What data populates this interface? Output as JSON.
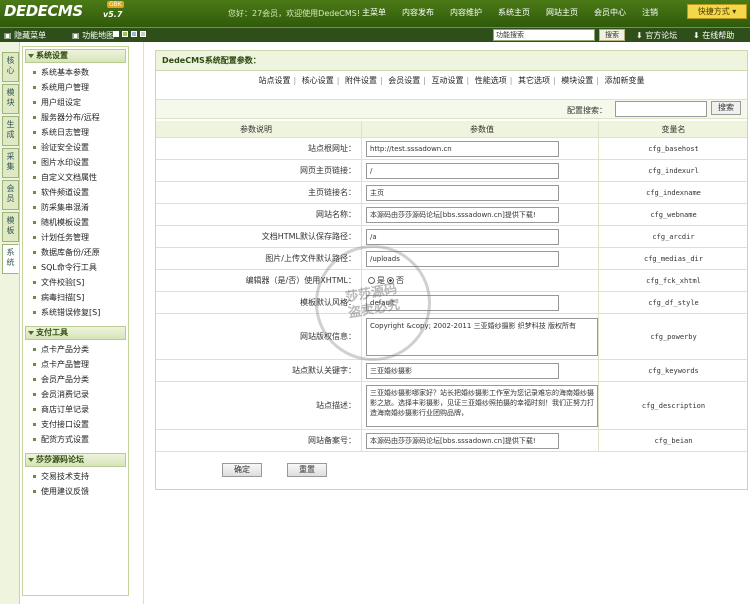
{
  "header": {
    "logo": "DEDECMS",
    "version": "v5.7",
    "badge": "GBK",
    "welcome": "您好：27会员，欢迎使用DedeCMS!",
    "nav": [
      "主菜单",
      "内容发布",
      "内容维护",
      "系统主页",
      "网站主页",
      "会员中心",
      "注销"
    ],
    "quick": "快捷方式"
  },
  "toolbar": {
    "hide_menu": "隐藏菜单",
    "func_map": "功能地图",
    "search_value": "功能搜索",
    "search_btn": "搜索",
    "official": "官方论坛",
    "help": "在线帮助",
    "colors": [
      "#ffffff",
      "#9cc45a",
      "#9bb7d6",
      "#c9c9c9"
    ]
  },
  "left_tabs": [
    "核心",
    "模块",
    "生成",
    "采集",
    "会员",
    "模板",
    "系统"
  ],
  "sidebar": {
    "sections": [
      {
        "title": "系统设置",
        "items": [
          "系统基本参数",
          "系统用户管理",
          "用户组设定",
          "服务器分布/远程",
          "系统日志管理",
          "验证安全设置",
          "图片水印设置",
          "自定义文档属性",
          "软件频道设置",
          "防采集串混淆",
          "随机模板设置",
          "计划任务管理",
          "数据库备份/还原",
          "SQL命令行工具",
          "文件校验[S]",
          "病毒扫描[S]",
          "系统错误修复[S]"
        ]
      },
      {
        "title": "支付工具",
        "items": [
          "点卡产品分类",
          "点卡产品管理",
          "会员产品分类",
          "会员消费记录",
          "商店订单记录",
          "支付接口设置",
          "配货方式设置"
        ]
      },
      {
        "title": "莎莎源码论坛",
        "items": [
          "交易技术支持",
          "使用建议反馈"
        ]
      }
    ]
  },
  "main": {
    "title": "DedeCMS系统配置参数：",
    "tabs": [
      "站点设置",
      "核心设置",
      "附件设置",
      "会员设置",
      "互动设置",
      "性能选项",
      "其它选项",
      "模块设置",
      "添加新变量"
    ],
    "search_label": "配置搜索：",
    "search_btn": "搜索",
    "columns": [
      "参数说明",
      "参数值",
      "变量名"
    ],
    "rows": [
      {
        "label": "站点根网址：",
        "value": "http://test.sssadown.cn",
        "var": "cfg_basehost"
      },
      {
        "label": "网页主页链接：",
        "value": "/",
        "var": "cfg_indexurl"
      },
      {
        "label": "主页链接名：",
        "value": "主页",
        "var": "cfg_indexname"
      },
      {
        "label": "网站名称：",
        "value": "本源码由莎莎源码论坛[bbs.sssadown.cn]提供下载!",
        "var": "cfg_webname"
      },
      {
        "label": "文档HTML默认保存路径：",
        "value": "/a",
        "var": "cfg_arcdir"
      },
      {
        "label": "图片/上传文件默认路径：",
        "value": "/uploads",
        "var": "cfg_medias_dir"
      },
      {
        "label": "编辑器（是/否）使用XHTML：",
        "value": "",
        "var": "cfg_fck_xhtml",
        "radio": [
          "是",
          "否"
        ],
        "radio_selected": 1
      },
      {
        "label": "模板默认风格：",
        "value": "default",
        "var": "cfg_df_style"
      },
      {
        "label": "网站版权信息：",
        "value": "Copyright &copy; 2002-2011 三亚婚纱摄影 织梦科技 版权所有",
        "var": "cfg_powerby",
        "textarea": true
      },
      {
        "label": "站点默认关键字：",
        "value": "三亚婚纱摄影",
        "var": "cfg_keywords"
      },
      {
        "label": "站点描述：",
        "value": "三亚婚纱摄影哪家好？站长把婚纱摄影工作室为您记录难忘的海南婚纱摄影之旅。选择丰彩摄影，见证三亚婚纱照拍摄的幸福时刻！我们正努力打造海南婚纱摄影行业团购品牌，",
        "var": "cfg_description",
        "textarea": true
      },
      {
        "label": "网站备案号：",
        "value": "本源码由莎莎源码论坛[bbs.sssadown.cn]提供下载!",
        "var": "cfg_beian"
      }
    ],
    "ok_btn": "确定",
    "reset_btn": "重置"
  },
  "watermark": {
    "line1": "莎莎源码",
    "line2": "盗卖必究"
  }
}
